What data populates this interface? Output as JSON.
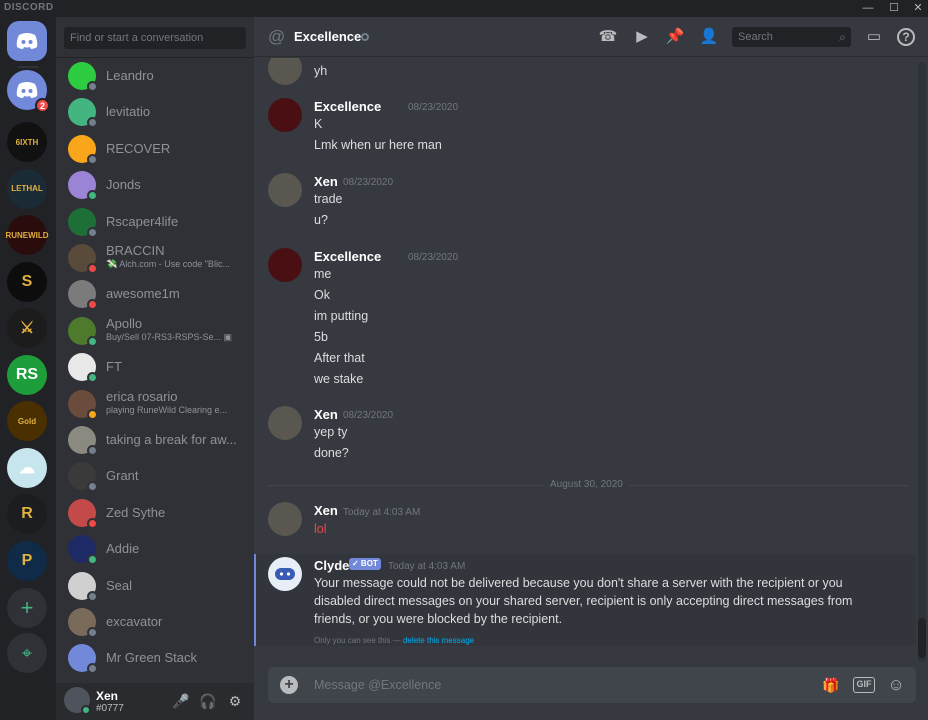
{
  "app": {
    "brand": "DISCORD"
  },
  "window": {
    "minimize": "—",
    "maximize": "☐",
    "close": "✕"
  },
  "rail": {
    "home_badge": "2",
    "servers": [
      {
        "name": "6IXTH",
        "label": "6IXTH",
        "color": "#111111"
      },
      {
        "name": "LETHAL",
        "label": "LETHAL",
        "color": "#1b2b35"
      },
      {
        "name": "RUNEWILD",
        "label": "RUNEWILD",
        "color": "#2a0c0c"
      },
      {
        "name": "S",
        "label": "S",
        "color": "#0d0d0d"
      },
      {
        "name": "sword",
        "label": "⚔",
        "color": "#1c1c1c"
      },
      {
        "name": "RS",
        "label": "RS",
        "color": "#1e9e3a"
      },
      {
        "name": "Legit Gold",
        "label": "Gold",
        "color": "#4a3000"
      },
      {
        "name": "cloud",
        "label": "☁",
        "color": "#c7e5ec"
      },
      {
        "name": "R",
        "label": "R",
        "color": "#1b1d20"
      },
      {
        "name": "P",
        "label": "P",
        "color": "#0f2b47"
      }
    ],
    "add_server": "+",
    "explore": "⌖"
  },
  "dms": {
    "search_placeholder": "Find or start a conversation",
    "items": [
      {
        "name": "Leandro",
        "sub": "",
        "status": "#747f8d",
        "avatar": "#2ecc40"
      },
      {
        "name": "levitatio",
        "sub": "",
        "status": "#747f8d",
        "avatar": "#43b581"
      },
      {
        "name": "RECOVER",
        "sub": "",
        "status": "#747f8d",
        "avatar": "#faa61a"
      },
      {
        "name": "Jonds",
        "sub": "",
        "status": "#43b581",
        "avatar": "#9b84d6"
      },
      {
        "name": "Rscaper4life",
        "sub": "",
        "status": "#747f8d",
        "avatar": "#1e6e38"
      },
      {
        "name": "BRACCIN",
        "sub": "💸 Alch.com - Use code \"Blic...",
        "status": "#f04747",
        "avatar": "#5a4a3a"
      },
      {
        "name": "awesome1m",
        "sub": "",
        "status": "#f04747",
        "avatar": "#7b7b7b"
      },
      {
        "name": "Apollo",
        "sub": "Buy/Sell 07-RS3-RSPS-Se... ▣",
        "status": "#43b581",
        "avatar": "#4e7a2e"
      },
      {
        "name": "FT",
        "sub": "",
        "status": "#43b581",
        "avatar": "#e8e8e8"
      },
      {
        "name": "erica rosario",
        "sub": "playing RuneWild Clearing e...",
        "status": "#faa61a",
        "avatar": "#6b4b3b"
      },
      {
        "name": "taking a break for aw...",
        "sub": "",
        "status": "#747f8d",
        "avatar": "#8a8a80"
      },
      {
        "name": "Grant",
        "sub": "",
        "status": "#747f8d",
        "avatar": "#3a3a3a"
      },
      {
        "name": "Zed Sythe",
        "sub": "",
        "status": "#f04747",
        "avatar": "#c44a4a"
      },
      {
        "name": "Addie",
        "sub": "",
        "status": "#43b581",
        "avatar": "#1e2a66"
      },
      {
        "name": "Seal",
        "sub": "",
        "status": "#747f8d",
        "avatar": "#d0d0d0"
      },
      {
        "name": "excavator",
        "sub": "",
        "status": "#747f8d",
        "avatar": "#7a6a5a"
      },
      {
        "name": "Mr Green Stack",
        "sub": "",
        "status": "#747f8d",
        "avatar": "#7289da"
      }
    ]
  },
  "user": {
    "name": "Xen",
    "tag": "#0777",
    "mic": "🎤",
    "headset": "🎧",
    "settings": "⚙"
  },
  "header": {
    "at": "@",
    "title": "Excellence",
    "search_placeholder": "Search",
    "search_icon": "⌕",
    "call": "☎",
    "video": "▶",
    "pin": "📌",
    "add_friend": "👤",
    "inbox": "▭",
    "help": "?"
  },
  "messages": {
    "top_line": "yh",
    "groups": [
      {
        "author": "Excellence",
        "time": "08/23/2020",
        "avatar": "#4a0f12",
        "lines": [
          "K",
          "Lmk when ur here man"
        ]
      },
      {
        "author": "Xen",
        "time": "08/23/2020",
        "avatar": "#5a5750",
        "lines": [
          "trade",
          "u?"
        ]
      },
      {
        "author": "Excellence",
        "time": "08/23/2020",
        "avatar": "#4a0f12",
        "lines": [
          "me",
          "Ok",
          "im putting",
          "5b",
          "After that",
          "we stake"
        ]
      },
      {
        "author": "Xen",
        "time": "08/23/2020",
        "avatar": "#5a5750",
        "lines": [
          "yep ty",
          "done?"
        ]
      }
    ],
    "date_divider": "August 30, 2020",
    "last_group": {
      "author": "Xen",
      "time": "Today at 4:03 AM",
      "line": "lol"
    },
    "clyde": {
      "author": "Clyde",
      "bot_badge": "✓ BOT",
      "time": "Today at 4:03 AM",
      "text": "Your message could not be delivered because you don't share a server with the recipient or you disabled direct messages on your shared server, recipient is only accepting direct messages from friends, or you were blocked by the recipient.",
      "note": "Only you can see this —",
      "note_link": "delete this message"
    }
  },
  "composer": {
    "placeholder": "Message @Excellence",
    "plus": "+",
    "gift": "🎁",
    "gif": "GIF",
    "emoji": "☺"
  }
}
